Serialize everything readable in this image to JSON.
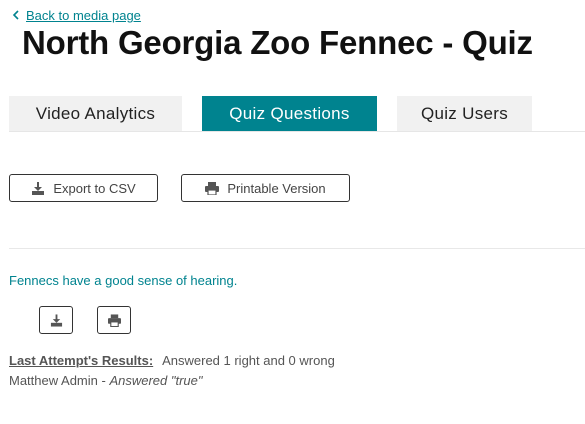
{
  "nav": {
    "back_label": "Back to media page"
  },
  "page": {
    "title": "North Georgia Zoo Fennec - Quiz"
  },
  "tabs": [
    {
      "label": "Video Analytics",
      "active": false
    },
    {
      "label": "Quiz Questions",
      "active": true
    },
    {
      "label": "Quiz Users",
      "active": false
    }
  ],
  "actions": {
    "export_label": "Export to CSV",
    "export_icon": "download-icon",
    "print_label": "Printable Version",
    "print_icon": "printer-icon"
  },
  "question": {
    "text": "Fennecs have a good sense of hearing.",
    "download_icon": "download-icon",
    "print_icon": "printer-icon"
  },
  "results": {
    "label": "Last Attempt's Results:",
    "summary": "Answered 1 right and 0 wrong",
    "user": "Matthew Admin",
    "separator": " - ",
    "answer": "Answered \"true\""
  },
  "colors": {
    "accent": "#00838f",
    "tab_inactive_bg": "#f1f1f1",
    "title": "#111111",
    "text": "#555555"
  }
}
